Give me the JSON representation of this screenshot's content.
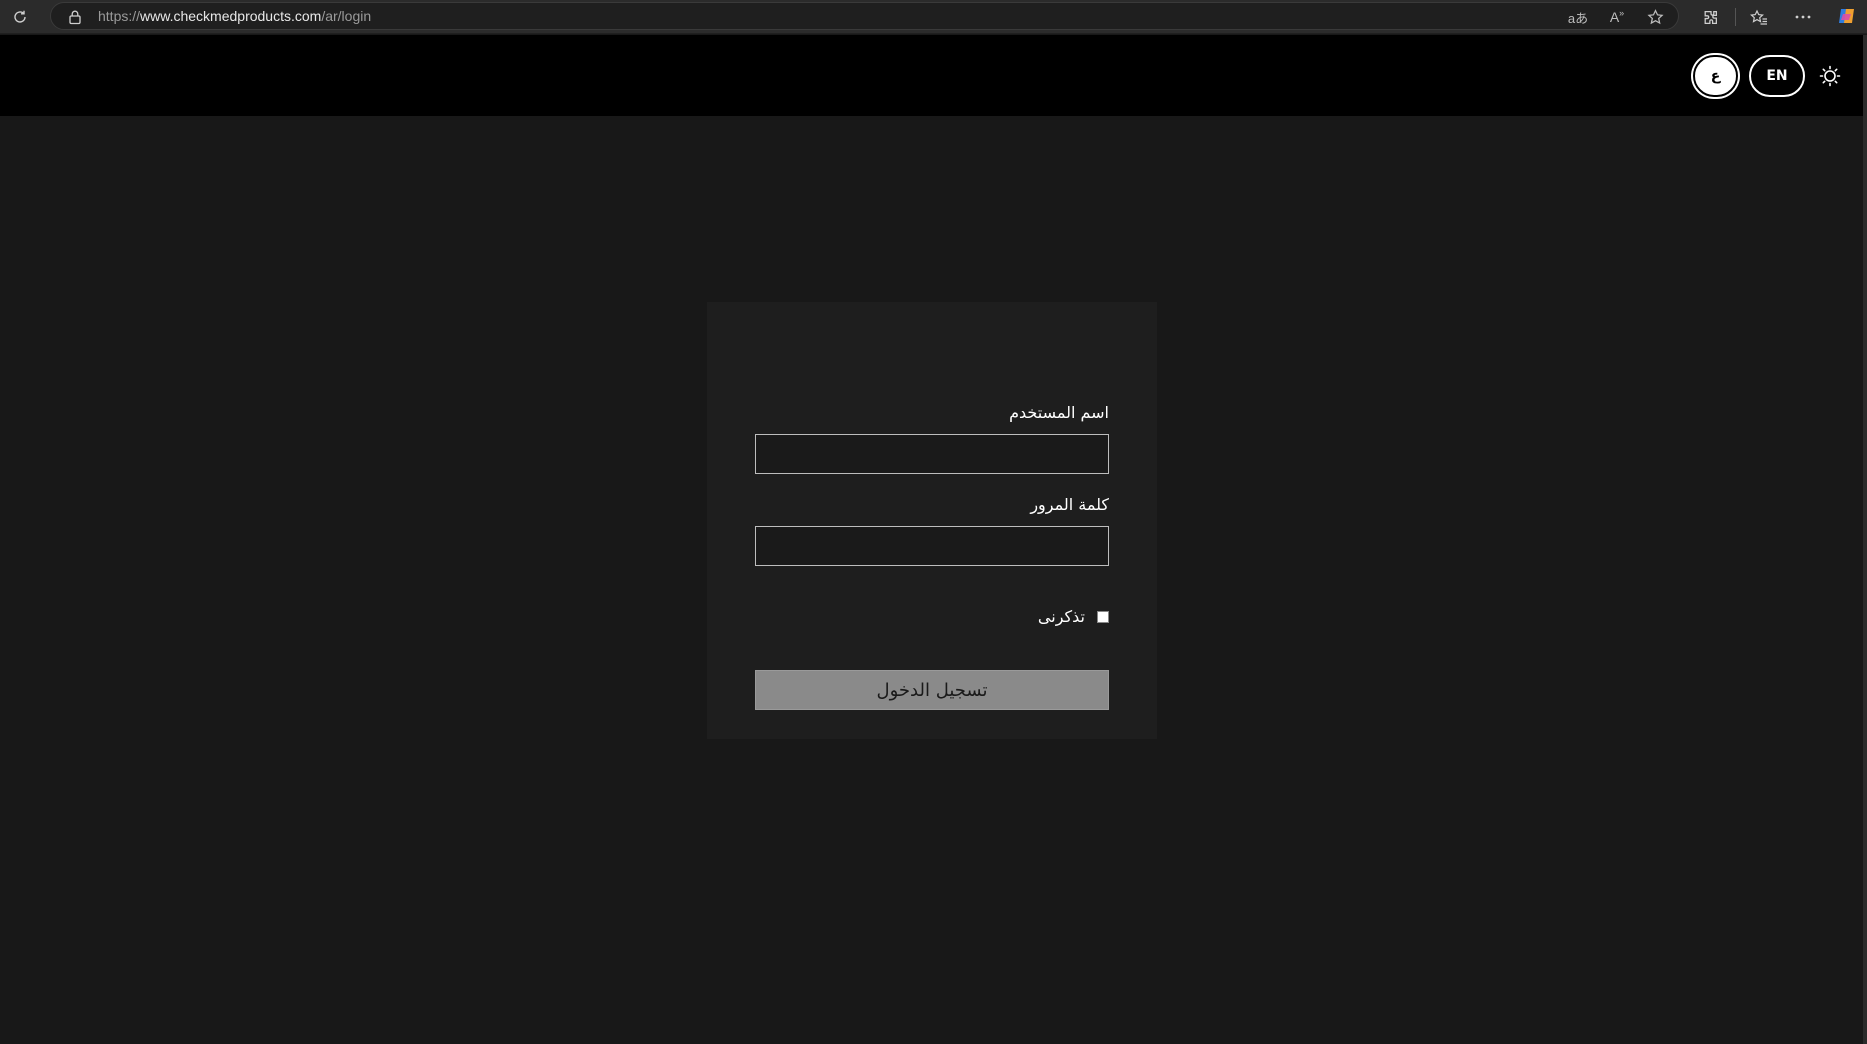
{
  "browser": {
    "url_scheme": "https://",
    "url_host": "www.checkmedproducts.com",
    "url_path": "/ar/login",
    "read_aloud_label": "A",
    "translate_label": "aあ"
  },
  "header": {
    "lang_ar_label": "ع",
    "lang_en_label": "EN"
  },
  "login": {
    "username_label": "اسم المستخدم",
    "username_value": "",
    "password_label": "كلمة المرور",
    "password_value": "",
    "remember_label": "تذكرنى",
    "remember_checked": false,
    "submit_label": "تسجيل الدخول"
  },
  "colors": {
    "page_bg": "#181818",
    "header_bg": "#000000",
    "card_bg": "#1e1e1e",
    "submit_bg": "#8a8a8a"
  },
  "icons": [
    "refresh-icon",
    "lock-icon",
    "translate-icon",
    "read-aloud-icon",
    "favorite-star-icon",
    "extensions-icon",
    "favorites-collection-icon",
    "more-icon",
    "copilot-icon",
    "sun-icon"
  ]
}
